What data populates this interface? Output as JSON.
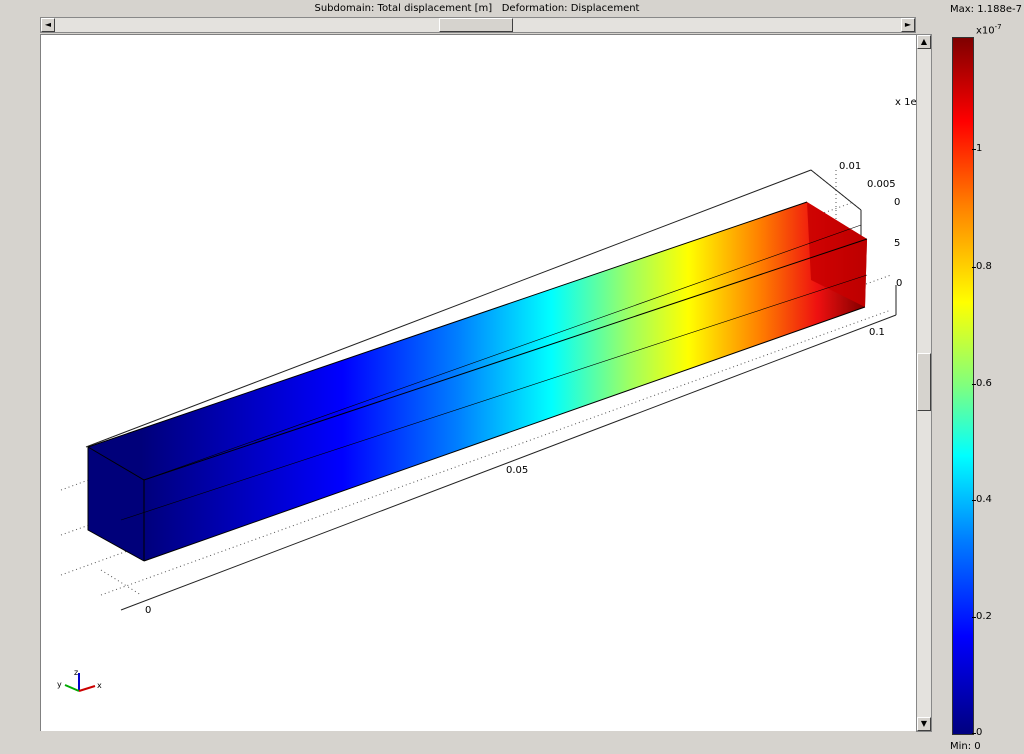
{
  "title": {
    "left": "Subdomain: Total displacement [m]",
    "right": "Deformation: Displacement"
  },
  "scrollbar": {
    "left_arrow": "◄",
    "right_arrow": "►",
    "up_arrow": "▲",
    "down_arrow": "▼"
  },
  "plot": {
    "exponent_label": "x 1e",
    "x_ticks": [
      "0",
      "0.05",
      "0.1"
    ],
    "y_ticks": [
      "0.01",
      "0.005"
    ],
    "z_ticks": [
      "0",
      "5",
      "0"
    ],
    "triad": {
      "z": "z",
      "y": "y",
      "x": "x"
    }
  },
  "colorbar": {
    "max_label": "Max: 1.188e-7",
    "min_label": "Min: 0",
    "exponent_base": "x10",
    "exponent_power": "-7",
    "ticks": [
      "1",
      "0.8",
      "0.6",
      "0.4",
      "0.2",
      "0"
    ],
    "colormap": [
      "#00007f",
      "#0000ff",
      "#007fff",
      "#00ffff",
      "#7fff7f",
      "#ffff00",
      "#ff7f00",
      "#ff0000",
      "#7f0000"
    ]
  }
}
